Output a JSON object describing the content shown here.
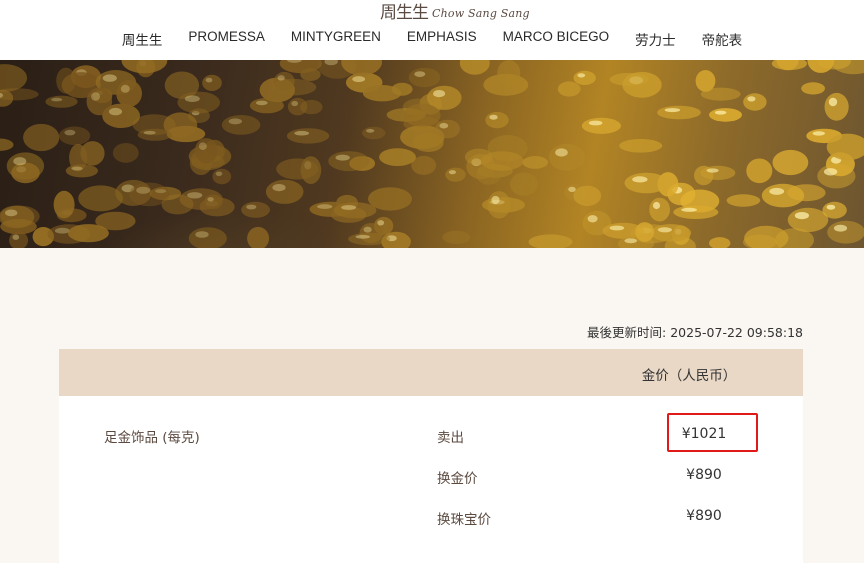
{
  "header": {
    "logo_cn": "周生生",
    "logo_en": "Chow Sang Sang",
    "nav": [
      "周生生",
      "PROMESSA",
      "MINTYGREEN",
      "EMPHASIS",
      "MARCO BICEGO",
      "劳力士",
      "帝舵表"
    ]
  },
  "banner": {
    "image": "gold-grains-photo"
  },
  "updated": "最後更新时间: 2025-07-22 09:58:18",
  "table": {
    "price_header": "金价（人民币）",
    "product": "足金饰品 (每克)",
    "rows": [
      {
        "label": "卖出",
        "price": "¥1021"
      },
      {
        "label": "换金价",
        "price": "¥890"
      },
      {
        "label": "换珠宝价",
        "price": "¥890"
      }
    ]
  },
  "colors": {
    "page_bg": "#faf7f2",
    "table_header_bg": "#e8d8c5",
    "highlight_border": "#e01919",
    "label_text": "#5b4a40"
  }
}
